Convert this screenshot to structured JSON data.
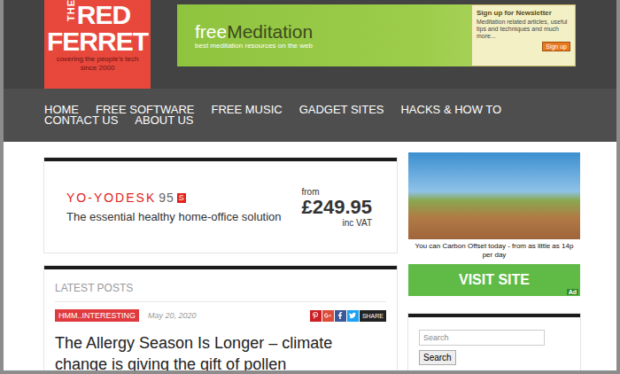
{
  "logo": {
    "the": "THE",
    "name_top": "RED",
    "name_bottom": "FERRET",
    "tagline_top": "covering the people's tech",
    "tagline_bottom": "since 2000"
  },
  "banner": {
    "brand_free": "free",
    "brand_name": "Meditation",
    "tagline": "best meditation resources on the web",
    "signup_title": "Sign up for Newsletter",
    "signup_text": "Meditation related articles, useful tips and techniques and much more...",
    "signup_button": "Sign up"
  },
  "nav": {
    "items": [
      {
        "label": "HOME"
      },
      {
        "label": "FREE SOFTWARE"
      },
      {
        "label": "FREE MUSIC"
      },
      {
        "label": "GADGET SITES"
      },
      {
        "label": "HACKS & HOW TO"
      },
      {
        "label": "CONTACT US"
      },
      {
        "label": "ABOUT US"
      }
    ]
  },
  "ad": {
    "brand": "YO-YODESK",
    "model": "95",
    "badge": "S",
    "tagline": "The essential healthy home-office solution",
    "from": "from",
    "price": "£249.95",
    "vat": "inc VAT"
  },
  "side_ad": {
    "caption": "You can Carbon Offset today - from as little as 14p per day",
    "button": "VISIT SITE",
    "badge": "Ad"
  },
  "posts": {
    "heading": "LATEST POSTS",
    "category": "HMM..INTERESTING",
    "date": "May 20, 2020",
    "share_buttons": [
      {
        "kind": "pinterest",
        "color": "#cb2027"
      },
      {
        "kind": "googleplus",
        "color": "#dd4b39"
      },
      {
        "kind": "facebook",
        "color": "#3b5998"
      },
      {
        "kind": "twitter",
        "color": "#1da1f2"
      }
    ],
    "share_label": "SHARE",
    "title": "The Allergy Season Is Longer – climate change is giving the gift of pollen"
  },
  "search": {
    "placeholder": "Search",
    "button": "Search"
  }
}
